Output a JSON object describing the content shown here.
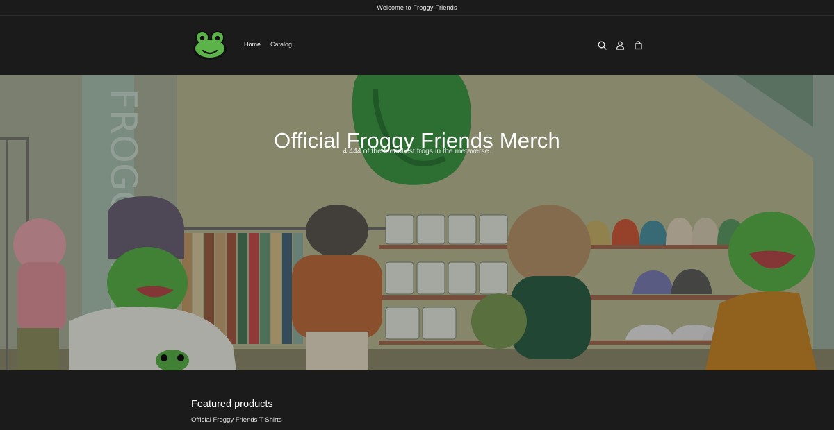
{
  "announcement": {
    "text": "Welcome to Froggy Friends"
  },
  "header": {
    "logo_icon": "frog-logo-icon",
    "nav": [
      {
        "label": "Home",
        "active": true
      },
      {
        "label": "Catalog",
        "active": false
      }
    ],
    "icons": [
      "search-icon",
      "account-icon",
      "cart-icon"
    ]
  },
  "hero": {
    "title": "Official Froggy Friends Merch",
    "subtitle": "4,444 of the friendliest frogs in the metaverse."
  },
  "featured": {
    "heading": "Featured products",
    "collection_label": "Official Froggy Friends T-Shirts"
  },
  "colors": {
    "background": "#1b1b1b",
    "frog_green": "#5bb34a",
    "text": "#ffffff"
  }
}
